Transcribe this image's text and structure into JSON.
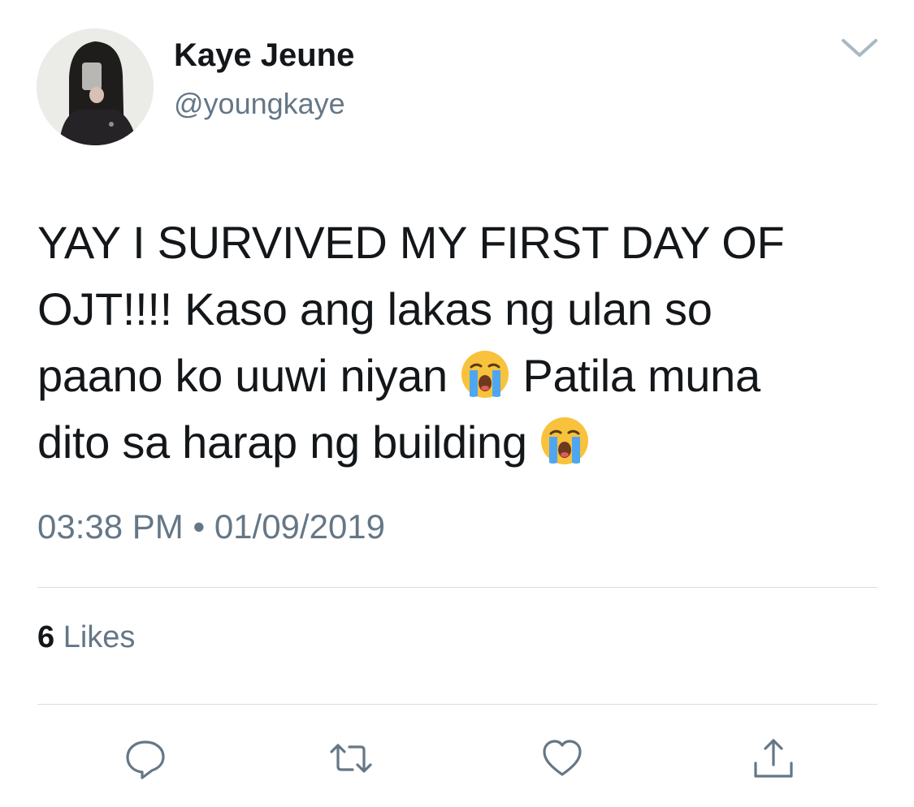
{
  "author": {
    "display_name": "Kaye Jeune",
    "handle": "@youngkaye"
  },
  "tweet": {
    "lines": [
      {
        "segments": [
          "YAY I SURVIVED MY FIRST DAY OF"
        ]
      },
      {
        "segments": [
          "OJT!!!! Kaso ang lakas ng ulan so"
        ]
      },
      {
        "segments": [
          "paano ko uuwi niyan ",
          "loudly-crying-face-emoji",
          " Patila muna"
        ]
      },
      {
        "segments": [
          "dito sa harap ng building ",
          "loudly-crying-face-emoji"
        ]
      }
    ],
    "timestamp": "03:38 PM • 01/09/2019"
  },
  "stats": {
    "likes_count": "6",
    "likes_label": "Likes"
  },
  "actions": [
    {
      "name": "reply-button",
      "icon": "reply-icon"
    },
    {
      "name": "retweet-button",
      "icon": "retweet-icon"
    },
    {
      "name": "like-button",
      "icon": "heart-icon"
    },
    {
      "name": "share-button",
      "icon": "share-icon"
    }
  ],
  "colors": {
    "primary_text": "#14171a",
    "secondary_text": "#657786",
    "icon": "#657786",
    "divider": "#d8dde1"
  }
}
